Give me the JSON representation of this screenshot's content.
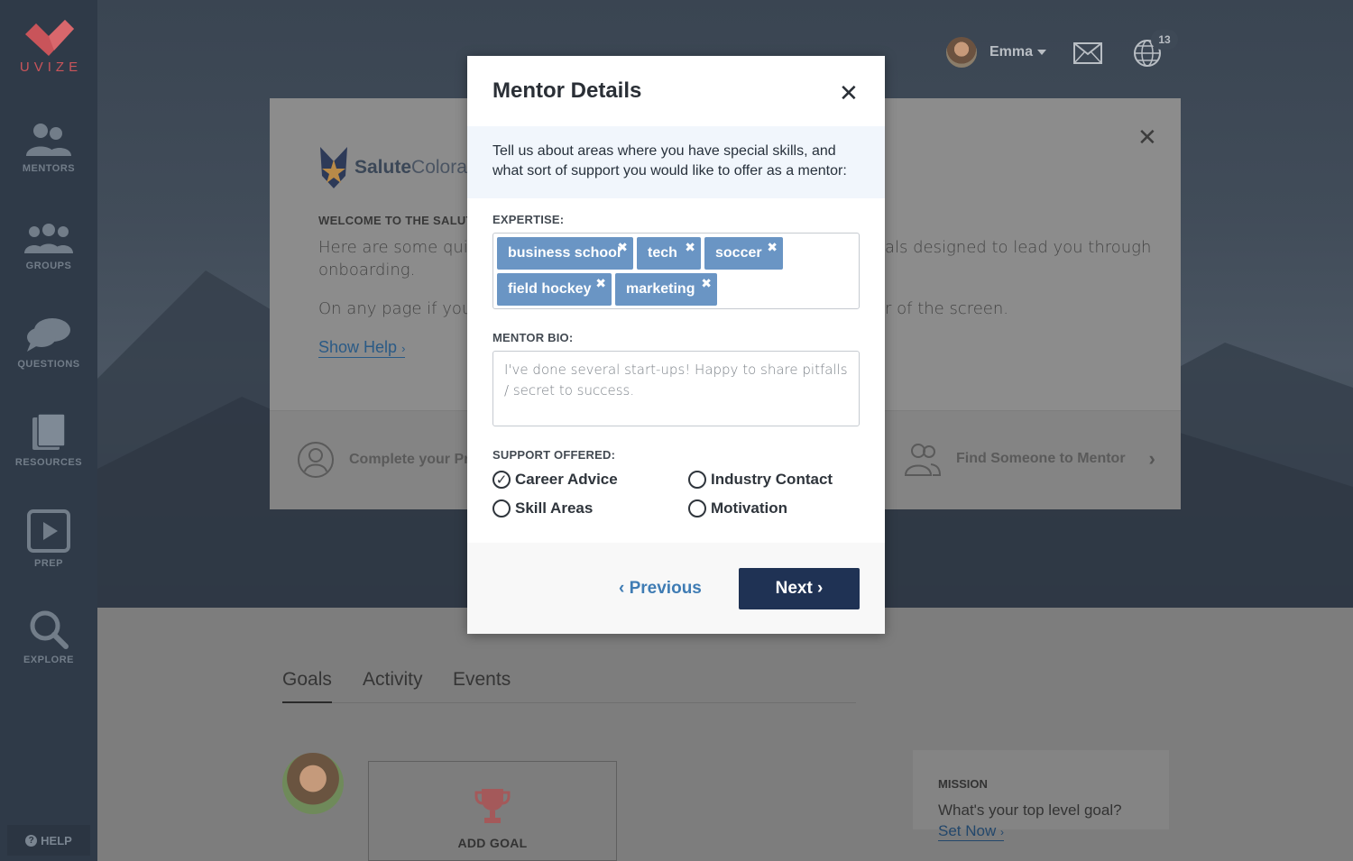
{
  "brand": {
    "name": "UVIZE"
  },
  "sidebar": {
    "items": [
      {
        "label": "MENTORS",
        "icon": "mentors-icon"
      },
      {
        "label": "GROUPS",
        "icon": "groups-icon"
      },
      {
        "label": "QUESTIONS",
        "icon": "questions-icon"
      },
      {
        "label": "RESOURCES",
        "icon": "resources-icon"
      },
      {
        "label": "PREP",
        "icon": "play-icon"
      },
      {
        "label": "EXPLORE",
        "icon": "search-icon"
      }
    ],
    "help_label": "HELP"
  },
  "header": {
    "user_name": "Emma",
    "notification_count": "13"
  },
  "welcome_card": {
    "logo_bold": "Salute",
    "logo_light": "Colorado",
    "heading": "WELCOME TO THE SALUTE",
    "line1_left": "Here are some quick ",
    "line1_right": "als designed to lead you through",
    "line2": "onboarding.",
    "line3_left": "On any page if you ne",
    "line3_right": "r of the screen.",
    "show_help": "Show Help",
    "step_left": "Complete your Pro",
    "step_right": "Find Someone to Mentor"
  },
  "tabs": [
    "Goals",
    "Activity",
    "Events"
  ],
  "add_goal": {
    "label": "ADD GOAL"
  },
  "mission": {
    "title": "MISSION",
    "question": "What's your top level goal?",
    "link": "Set Now"
  },
  "modal": {
    "title": "Mentor Details",
    "intro": "Tell us about areas where you have special skills, and what sort of support you would like to offer as a mentor:",
    "expertise_label": "EXPERTISE:",
    "tags": [
      "business school",
      "tech",
      "soccer",
      "field hockey",
      "marketing"
    ],
    "bio_label": "MENTOR BIO:",
    "bio_text": "I've done several start-ups! Happy to share pitfalls / secret to success.",
    "support_label": "SUPPORT OFFERED:",
    "support_options": [
      {
        "label": "Career Advice",
        "checked": true
      },
      {
        "label": "Industry Contact",
        "checked": false
      },
      {
        "label": "Skill Areas",
        "checked": false
      },
      {
        "label": "Motivation",
        "checked": false
      }
    ],
    "previous": "‹ Previous",
    "next": "Next ›"
  },
  "colors": {
    "accent": "#1f3254",
    "tag": "#6a95c4",
    "brand": "#c9545a",
    "link": "#3f7cb4"
  }
}
